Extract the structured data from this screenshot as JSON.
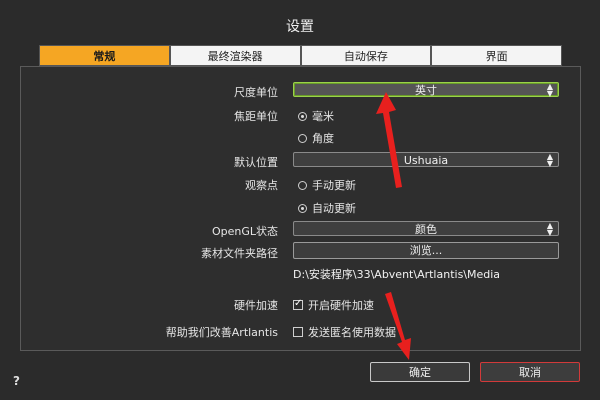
{
  "dialog": {
    "title": "设置"
  },
  "tabs": [
    {
      "label": "常规"
    },
    {
      "label": "最终渲染器"
    },
    {
      "label": "自动保存"
    },
    {
      "label": "界面"
    }
  ],
  "settings": {
    "unit_label": "尺度单位",
    "unit_value": "英寸",
    "focal_label": "焦距单位",
    "focal_opt1": "毫米",
    "focal_opt2": "角度",
    "position_label": "默认位置",
    "position_value": "Ushuaia",
    "observer_label": "观察点",
    "observer_opt1": "手动更新",
    "observer_opt2": "自动更新",
    "opengl_label": "OpenGL状态",
    "opengl_value": "颜色",
    "folder_label": "素材文件夹路径",
    "browse_label": "浏览...",
    "folder_path": "D:\\安装程序\\33\\Abvent\\Artlantis\\Media",
    "hw_label": "硬件加速",
    "hw_option": "开启硬件加速",
    "help_label": "帮助我们改善Artlantis",
    "help_option": "发送匿名使用数据"
  },
  "footer": {
    "ok_label": "确定",
    "cancel_label": "取消",
    "help_icon": "?"
  }
}
